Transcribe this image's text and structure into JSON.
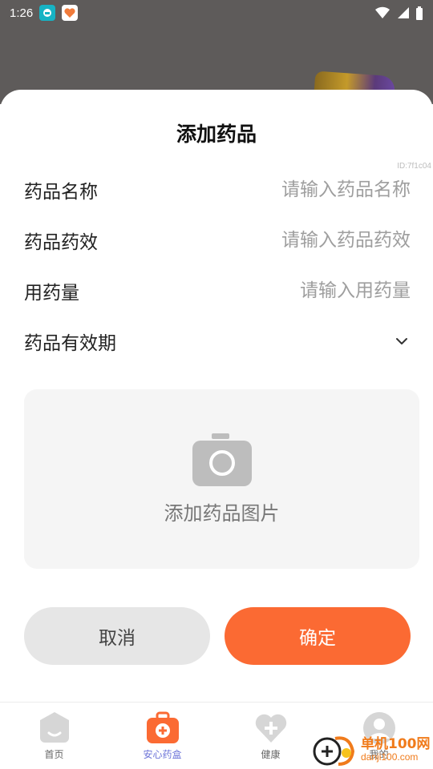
{
  "status_bar": {
    "time": "1:26"
  },
  "sheet": {
    "title": "添加药品",
    "debug_id": "ID:7f1c04"
  },
  "form": {
    "name": {
      "label": "药品名称",
      "placeholder": "请输入药品名称",
      "value": ""
    },
    "effect": {
      "label": "药品药效",
      "placeholder": "请输入药品药效",
      "value": ""
    },
    "dosage": {
      "label": "用药量",
      "placeholder": "请输入用药量",
      "value": ""
    },
    "expiry": {
      "label": "药品有效期",
      "icon": "chevron-down-icon"
    }
  },
  "photo": {
    "label": "添加药品图片",
    "icon": "camera-icon"
  },
  "buttons": {
    "cancel": "取消",
    "confirm": "确定"
  },
  "tabs": [
    {
      "label": "首页",
      "icon": "home-icon",
      "active": false
    },
    {
      "label": "安心药盒",
      "icon": "medicine-box-icon",
      "active": true
    },
    {
      "label": "健康",
      "icon": "heart-plus-icon",
      "active": false
    },
    {
      "label": "我的",
      "icon": "user-icon",
      "active": false
    }
  ],
  "watermark": {
    "site_name": "单机100网",
    "site_url": "danji100.com"
  },
  "colors": {
    "accent": "#fb6a33",
    "active_tab": "#6d74d8",
    "backdrop": "#5e5b5a",
    "photo_bg": "#f5f5f5"
  }
}
